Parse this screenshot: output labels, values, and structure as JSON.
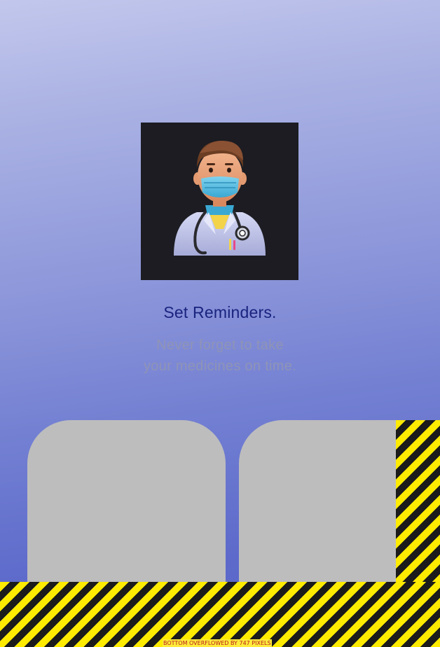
{
  "onboarding": {
    "illustration": "doctor-with-mask-and-stethoscope",
    "title": "Set Reminders.",
    "subtitle_line1": "Never forget to take",
    "subtitle_line2": "your medicines on time."
  },
  "debug": {
    "overflow_message": "BOTTOM OVERFLOWED BY 747 PIXELS"
  },
  "colors": {
    "title": "#1a237e",
    "subtitle": "#8f94b6",
    "card": "#bdbdbd",
    "warning_yellow": "#ffeb00",
    "warning_black": "#1b1b1b"
  }
}
